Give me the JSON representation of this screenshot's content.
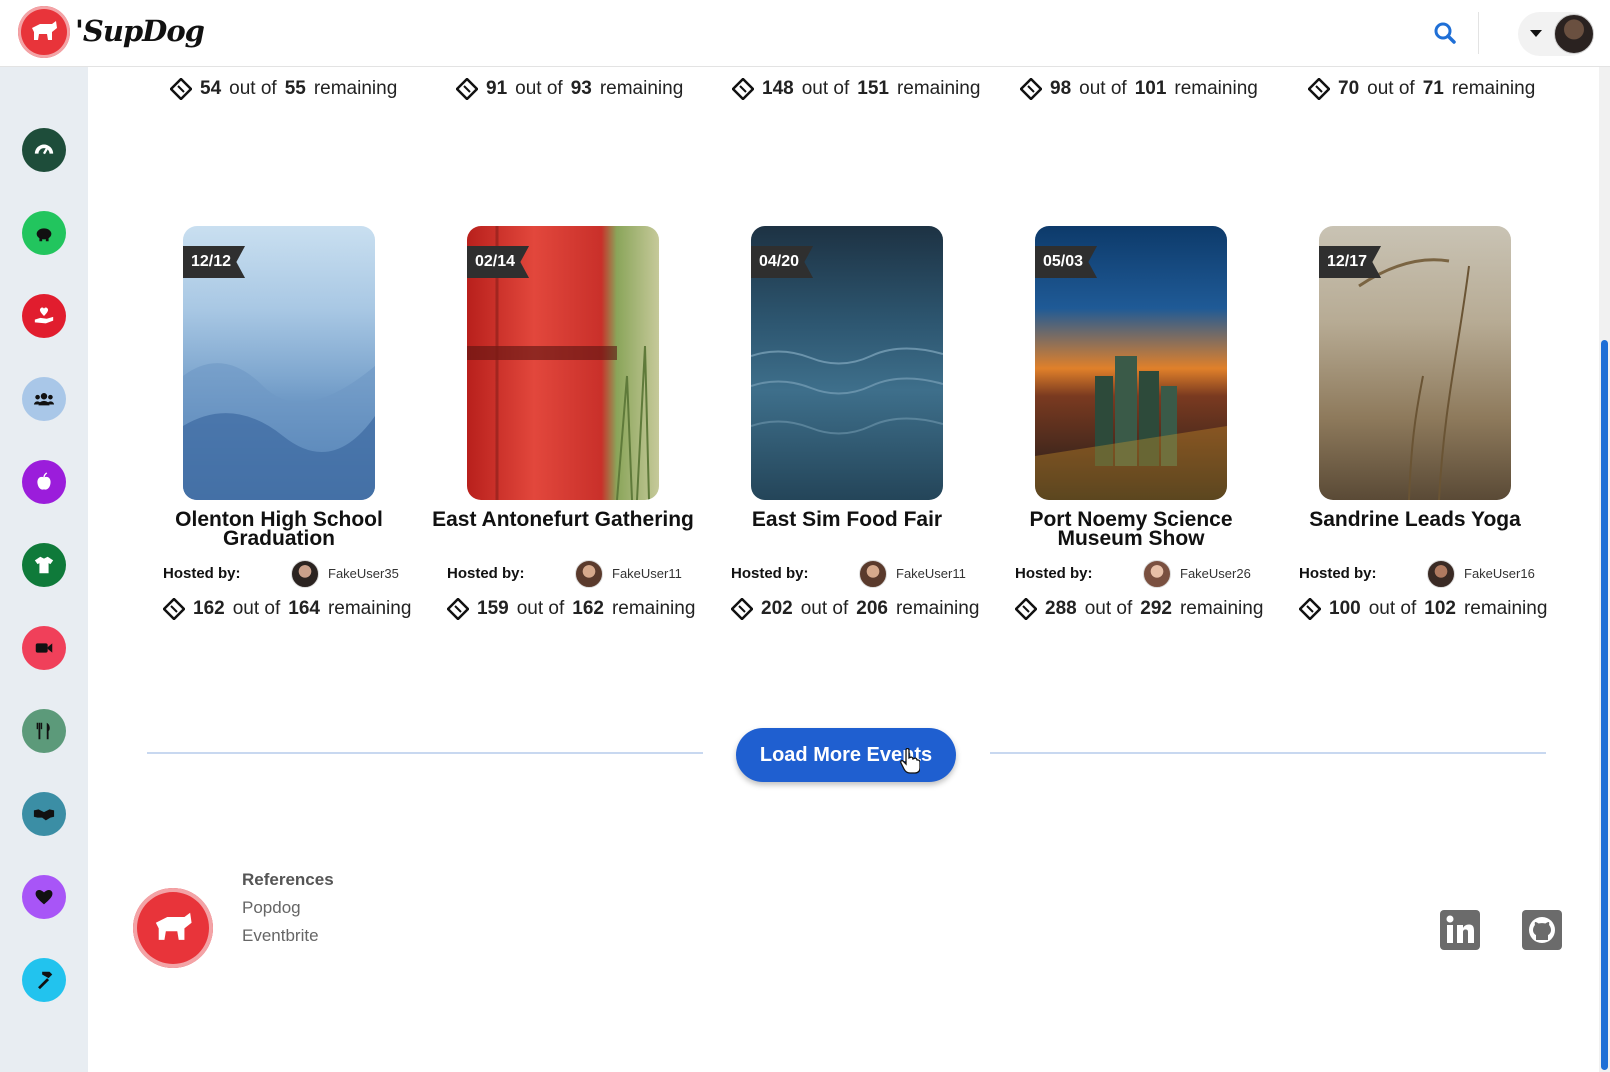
{
  "header": {
    "brand_name": "'SupDog"
  },
  "remaining_row": [
    {
      "left": "54",
      "total": "55"
    },
    {
      "left": "91",
      "total": "93"
    },
    {
      "left": "148",
      "total": "151"
    },
    {
      "left": "98",
      "total": "101"
    },
    {
      "left": "70",
      "total": "71"
    }
  ],
  "remaining_text": {
    "out_of": "out of",
    "remaining": "remaining"
  },
  "events": [
    {
      "date": "12/12",
      "title": "Olenton High School Graduation",
      "host": "FakeUser35",
      "left": "162",
      "total": "164"
    },
    {
      "date": "02/14",
      "title": "East Antonefurt Gathering",
      "host": "FakeUser11",
      "left": "159",
      "total": "162"
    },
    {
      "date": "04/20",
      "title": "East Sim Food Fair",
      "host": "FakeUser11",
      "left": "202",
      "total": "206"
    },
    {
      "date": "05/03",
      "title": "Port Noemy Science Museum Show",
      "host": "FakeUser26",
      "left": "288",
      "total": "292"
    },
    {
      "date": "12/17",
      "title": "Sandrine Leads Yoga",
      "host": "FakeUser16",
      "left": "100",
      "total": "102"
    }
  ],
  "hosted_by_label": "Hosted by:",
  "load_more_label": "Load More Events",
  "footer": {
    "references_title": "References",
    "links": [
      "Popdog",
      "Eventbrite"
    ]
  },
  "sidebar_icons": [
    {
      "name": "dashboard-icon",
      "color": "#1e4d3a"
    },
    {
      "name": "piggy-bank-icon",
      "color": "#22c55e"
    },
    {
      "name": "charity-hand-heart-icon",
      "color": "#e11d2e"
    },
    {
      "name": "users-group-icon",
      "color": "#a9c7e8"
    },
    {
      "name": "apple-icon",
      "color": "#9b1ddb"
    },
    {
      "name": "tshirt-icon",
      "color": "#0f7a3a"
    },
    {
      "name": "video-camera-icon",
      "color": "#f0405a"
    },
    {
      "name": "utensils-icon",
      "color": "#5c9a7a"
    },
    {
      "name": "handshake-icon",
      "color": "#3b8ea5"
    },
    {
      "name": "heart-icon",
      "color": "#a855f7"
    },
    {
      "name": "hammer-icon",
      "color": "#22c3ee"
    }
  ],
  "colors": {
    "accent": "#1f5fd0",
    "brand_red": "#e8343a",
    "sidebar_bg": "#e8edf2"
  }
}
